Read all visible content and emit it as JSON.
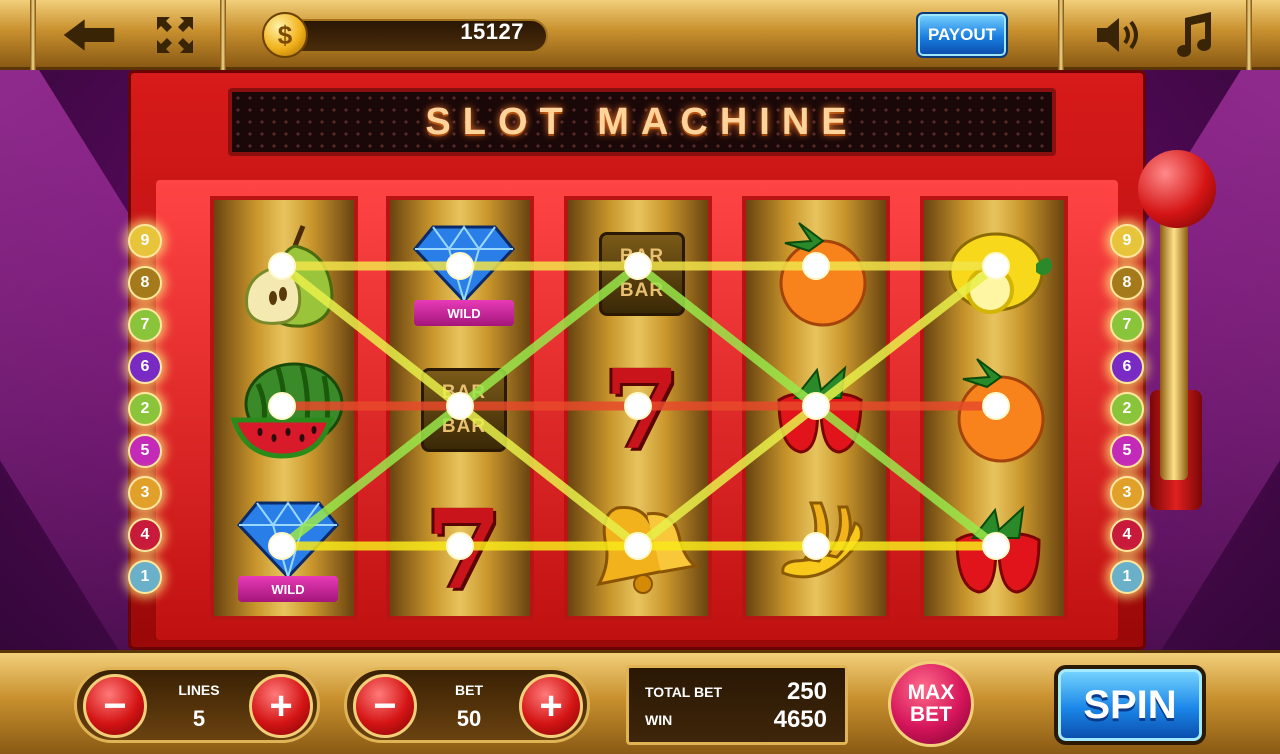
{
  "topbar": {
    "back_icon": "arrow-left-icon",
    "fullscreen_icon": "fullscreen-icon",
    "coin_icon": "coin-icon",
    "coin_symbol": "$",
    "balance": "15127",
    "payout_label": "PAYOUT",
    "sound_icon": "speaker-icon",
    "music_icon": "music-note-icon"
  },
  "title": "SLOT MACHINE",
  "reels": [
    [
      "pear",
      "watermelon",
      "wild-diamond"
    ],
    [
      "wild-diamond",
      "bar",
      "seven"
    ],
    [
      "bar",
      "seven",
      "bell"
    ],
    [
      "orange",
      "strawberry",
      "banana"
    ],
    [
      "lemon",
      "orange",
      "strawberry"
    ]
  ],
  "symbols": {
    "wild_label": "WILD",
    "bar_label": "BAR"
  },
  "paylines": {
    "left": [
      "9",
      "8",
      "7",
      "6",
      "2",
      "5",
      "3",
      "4",
      "1"
    ],
    "right": [
      "9",
      "8",
      "7",
      "6",
      "2",
      "5",
      "3",
      "4",
      "1"
    ],
    "colors": [
      "#f2d04a",
      "#c8a02a",
      "#9ad43a",
      "#8a3ad4",
      "#9ad43a",
      "#d43ac8",
      "#e0a02a",
      "#c81a3a",
      "#e8c43a"
    ]
  },
  "controls": {
    "lines_label": "LINES",
    "lines_value": "5",
    "bet_label": "BET",
    "bet_value": "50",
    "minus": "−",
    "plus": "+",
    "total_bet_label": "TOTAL BET",
    "total_bet_value": "250",
    "win_label": "WIN",
    "win_value": "4650",
    "max_bet_label": "MAX BET",
    "spin_label": "SPIN"
  },
  "colors": {
    "gold": "#c8902e",
    "cabinet_red": "#d81a1a",
    "button_blue": "#1a7ee0"
  }
}
